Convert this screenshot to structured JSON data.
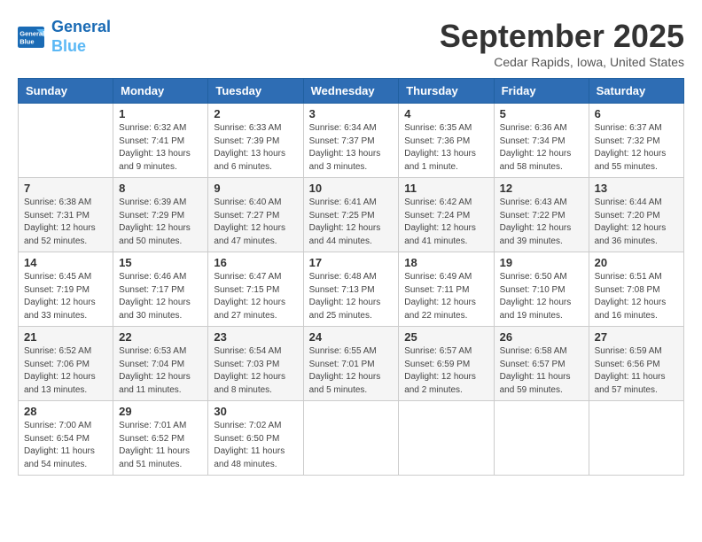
{
  "header": {
    "logo_line1": "General",
    "logo_line2": "Blue",
    "month_title": "September 2025",
    "location": "Cedar Rapids, Iowa, United States"
  },
  "days_of_week": [
    "Sunday",
    "Monday",
    "Tuesday",
    "Wednesday",
    "Thursday",
    "Friday",
    "Saturday"
  ],
  "weeks": [
    [
      {
        "day": "",
        "info": ""
      },
      {
        "day": "1",
        "info": "Sunrise: 6:32 AM\nSunset: 7:41 PM\nDaylight: 13 hours\nand 9 minutes."
      },
      {
        "day": "2",
        "info": "Sunrise: 6:33 AM\nSunset: 7:39 PM\nDaylight: 13 hours\nand 6 minutes."
      },
      {
        "day": "3",
        "info": "Sunrise: 6:34 AM\nSunset: 7:37 PM\nDaylight: 13 hours\nand 3 minutes."
      },
      {
        "day": "4",
        "info": "Sunrise: 6:35 AM\nSunset: 7:36 PM\nDaylight: 13 hours\nand 1 minute."
      },
      {
        "day": "5",
        "info": "Sunrise: 6:36 AM\nSunset: 7:34 PM\nDaylight: 12 hours\nand 58 minutes."
      },
      {
        "day": "6",
        "info": "Sunrise: 6:37 AM\nSunset: 7:32 PM\nDaylight: 12 hours\nand 55 minutes."
      }
    ],
    [
      {
        "day": "7",
        "info": "Sunrise: 6:38 AM\nSunset: 7:31 PM\nDaylight: 12 hours\nand 52 minutes."
      },
      {
        "day": "8",
        "info": "Sunrise: 6:39 AM\nSunset: 7:29 PM\nDaylight: 12 hours\nand 50 minutes."
      },
      {
        "day": "9",
        "info": "Sunrise: 6:40 AM\nSunset: 7:27 PM\nDaylight: 12 hours\nand 47 minutes."
      },
      {
        "day": "10",
        "info": "Sunrise: 6:41 AM\nSunset: 7:25 PM\nDaylight: 12 hours\nand 44 minutes."
      },
      {
        "day": "11",
        "info": "Sunrise: 6:42 AM\nSunset: 7:24 PM\nDaylight: 12 hours\nand 41 minutes."
      },
      {
        "day": "12",
        "info": "Sunrise: 6:43 AM\nSunset: 7:22 PM\nDaylight: 12 hours\nand 39 minutes."
      },
      {
        "day": "13",
        "info": "Sunrise: 6:44 AM\nSunset: 7:20 PM\nDaylight: 12 hours\nand 36 minutes."
      }
    ],
    [
      {
        "day": "14",
        "info": "Sunrise: 6:45 AM\nSunset: 7:19 PM\nDaylight: 12 hours\nand 33 minutes."
      },
      {
        "day": "15",
        "info": "Sunrise: 6:46 AM\nSunset: 7:17 PM\nDaylight: 12 hours\nand 30 minutes."
      },
      {
        "day": "16",
        "info": "Sunrise: 6:47 AM\nSunset: 7:15 PM\nDaylight: 12 hours\nand 27 minutes."
      },
      {
        "day": "17",
        "info": "Sunrise: 6:48 AM\nSunset: 7:13 PM\nDaylight: 12 hours\nand 25 minutes."
      },
      {
        "day": "18",
        "info": "Sunrise: 6:49 AM\nSunset: 7:11 PM\nDaylight: 12 hours\nand 22 minutes."
      },
      {
        "day": "19",
        "info": "Sunrise: 6:50 AM\nSunset: 7:10 PM\nDaylight: 12 hours\nand 19 minutes."
      },
      {
        "day": "20",
        "info": "Sunrise: 6:51 AM\nSunset: 7:08 PM\nDaylight: 12 hours\nand 16 minutes."
      }
    ],
    [
      {
        "day": "21",
        "info": "Sunrise: 6:52 AM\nSunset: 7:06 PM\nDaylight: 12 hours\nand 13 minutes."
      },
      {
        "day": "22",
        "info": "Sunrise: 6:53 AM\nSunset: 7:04 PM\nDaylight: 12 hours\nand 11 minutes."
      },
      {
        "day": "23",
        "info": "Sunrise: 6:54 AM\nSunset: 7:03 PM\nDaylight: 12 hours\nand 8 minutes."
      },
      {
        "day": "24",
        "info": "Sunrise: 6:55 AM\nSunset: 7:01 PM\nDaylight: 12 hours\nand 5 minutes."
      },
      {
        "day": "25",
        "info": "Sunrise: 6:57 AM\nSunset: 6:59 PM\nDaylight: 12 hours\nand 2 minutes."
      },
      {
        "day": "26",
        "info": "Sunrise: 6:58 AM\nSunset: 6:57 PM\nDaylight: 11 hours\nand 59 minutes."
      },
      {
        "day": "27",
        "info": "Sunrise: 6:59 AM\nSunset: 6:56 PM\nDaylight: 11 hours\nand 57 minutes."
      }
    ],
    [
      {
        "day": "28",
        "info": "Sunrise: 7:00 AM\nSunset: 6:54 PM\nDaylight: 11 hours\nand 54 minutes."
      },
      {
        "day": "29",
        "info": "Sunrise: 7:01 AM\nSunset: 6:52 PM\nDaylight: 11 hours\nand 51 minutes."
      },
      {
        "day": "30",
        "info": "Sunrise: 7:02 AM\nSunset: 6:50 PM\nDaylight: 11 hours\nand 48 minutes."
      },
      {
        "day": "",
        "info": ""
      },
      {
        "day": "",
        "info": ""
      },
      {
        "day": "",
        "info": ""
      },
      {
        "day": "",
        "info": ""
      }
    ]
  ]
}
